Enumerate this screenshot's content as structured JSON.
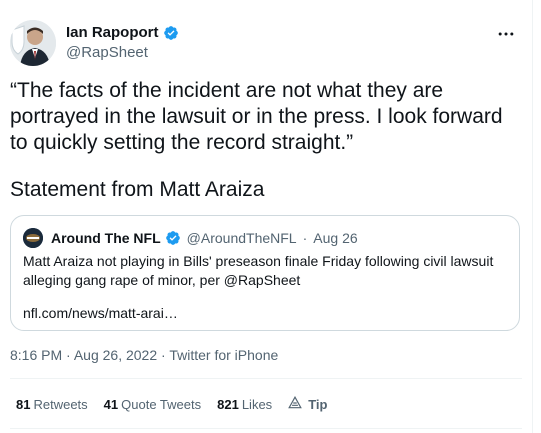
{
  "author": {
    "name": "Ian Rapoport",
    "handle": "@RapSheet"
  },
  "tweet": {
    "text": "“The facts of the incident are not what they are portrayed in the lawsuit or in the press. I look forward to quickly setting the record straight.”",
    "statement": "Statement from Matt Araiza"
  },
  "quote": {
    "name": "Around The NFL",
    "handle": "@AroundTheNFL",
    "separator": "·",
    "date": "Aug 26",
    "text": "Matt Araiza not playing in Bills' preseason finale Friday following civil lawsuit alleging gang rape of minor, per @RapSheet",
    "link": "nfl.com/news/matt-arai…"
  },
  "meta": {
    "time": "8:16 PM",
    "separator": "·",
    "date": "Aug 26, 2022",
    "source": "Twitter for iPhone"
  },
  "stats": {
    "retweets_count": "81",
    "retweets_label": "Retweets",
    "quotes_count": "41",
    "quotes_label": "Quote Tweets",
    "likes_count": "821",
    "likes_label": "Likes",
    "tip_label": "Tip"
  },
  "icons": {
    "verified": "verified-badge-icon",
    "more": "more-options-icon",
    "tip": "tip-icon"
  },
  "colors": {
    "verified": "#1d9bf0",
    "secondary_text": "#536471",
    "border": "#cfd9de"
  }
}
